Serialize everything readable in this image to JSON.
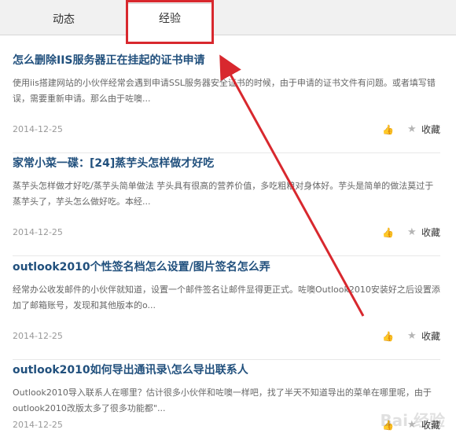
{
  "tabs": [
    {
      "label": "动态"
    },
    {
      "label": "经验"
    }
  ],
  "items": [
    {
      "title": "怎么删除IIS服务器正在挂起的证书申请",
      "summary": "使用iis搭建网站的小伙伴经常会遇到申请SSL服务器安全证书的时候，由于申请的证书文件有问题。或者填写错误，需要重新申请。那么由于咗噢...",
      "date": "2014-12-25",
      "collect_label": "收藏"
    },
    {
      "title": "家常小菜一碟：[24]蒸芋头怎样做才好吃",
      "summary": "蒸芋头怎样做才好吃/蒸芋头简单做法 芋头具有很高的营养价值，多吃粗粮对身体好。芋头是简单的做法莫过于蒸芋头了，芋头怎么做好吃。本经...",
      "date": "2014-12-25",
      "collect_label": "收藏"
    },
    {
      "title": "outlook2010个性签名档怎么设置/图片签名怎么弄",
      "summary": "经常办公收发邮件的小伙伴就知道，设置一个邮件签名让邮件显得更正式。咗噢Outlook2010安装好之后设置添加了邮箱账号，发现和其他版本的o...",
      "date": "2014-12-25",
      "collect_label": "收藏"
    },
    {
      "title": "outlook2010如何导出通讯录\\怎么导出联系人",
      "summary": "Outlook2010导入联系人在哪里？估计很多小伙伴和咗噢一样吧，找了半天不知道导出的菜单在哪里呢，由于outlook2010改版太多了很多功能都\"...",
      "date": "2014-12-25",
      "collect_label": "收藏"
    }
  ],
  "watermark": "Bai 经验",
  "colors": {
    "title": "#21507d",
    "highlight": "#d8282e",
    "arrow": "#d8282e"
  }
}
